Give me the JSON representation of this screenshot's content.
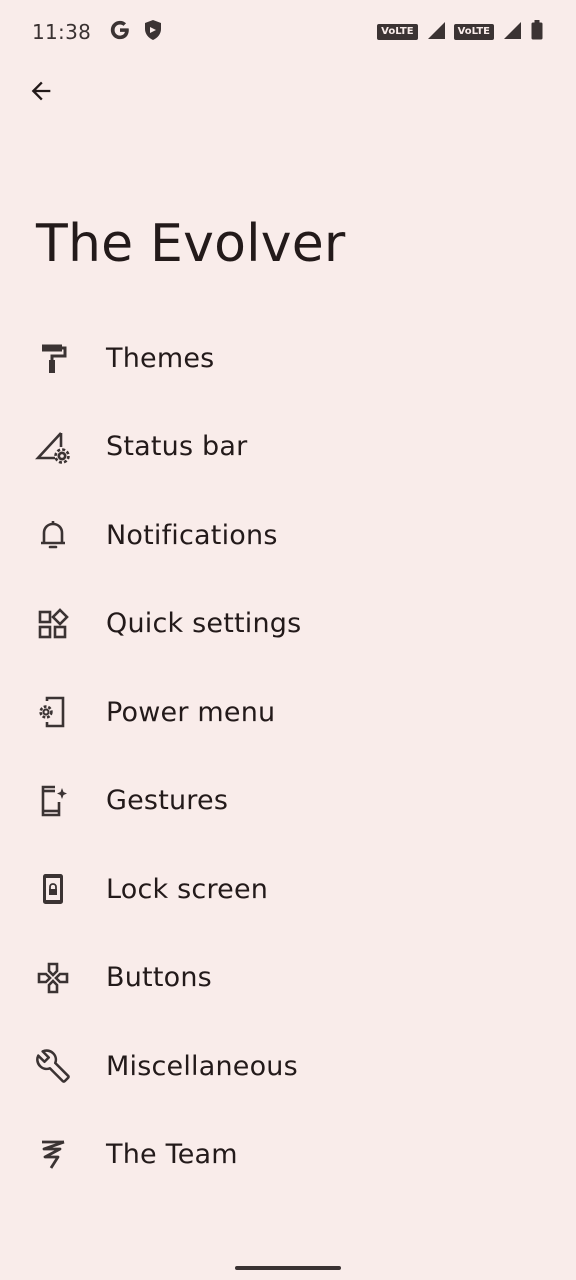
{
  "status_bar": {
    "time": "11:38",
    "left_icons": [
      "google-icon",
      "shield-icon"
    ],
    "network_badges": [
      "VoLTE",
      "VoLTE"
    ]
  },
  "header": {
    "title": "The Evolver"
  },
  "menu": {
    "items": [
      {
        "label": "Themes",
        "icon": "paint-roller-icon"
      },
      {
        "label": "Status bar",
        "icon": "signal-settings-icon"
      },
      {
        "label": "Notifications",
        "icon": "bell-icon"
      },
      {
        "label": "Quick settings",
        "icon": "widgets-icon"
      },
      {
        "label": "Power menu",
        "icon": "phone-settings-icon"
      },
      {
        "label": "Gestures",
        "icon": "phone-sparkle-icon"
      },
      {
        "label": "Lock screen",
        "icon": "phone-lock-icon"
      },
      {
        "label": "Buttons",
        "icon": "gamepad-icon"
      },
      {
        "label": "Miscellaneous",
        "icon": "wrench-icon"
      },
      {
        "label": "The Team",
        "icon": "team-logo-icon"
      }
    ]
  },
  "colors": {
    "background": "#f9ecea",
    "text": "#231a1a",
    "icon": "#3b3333"
  }
}
